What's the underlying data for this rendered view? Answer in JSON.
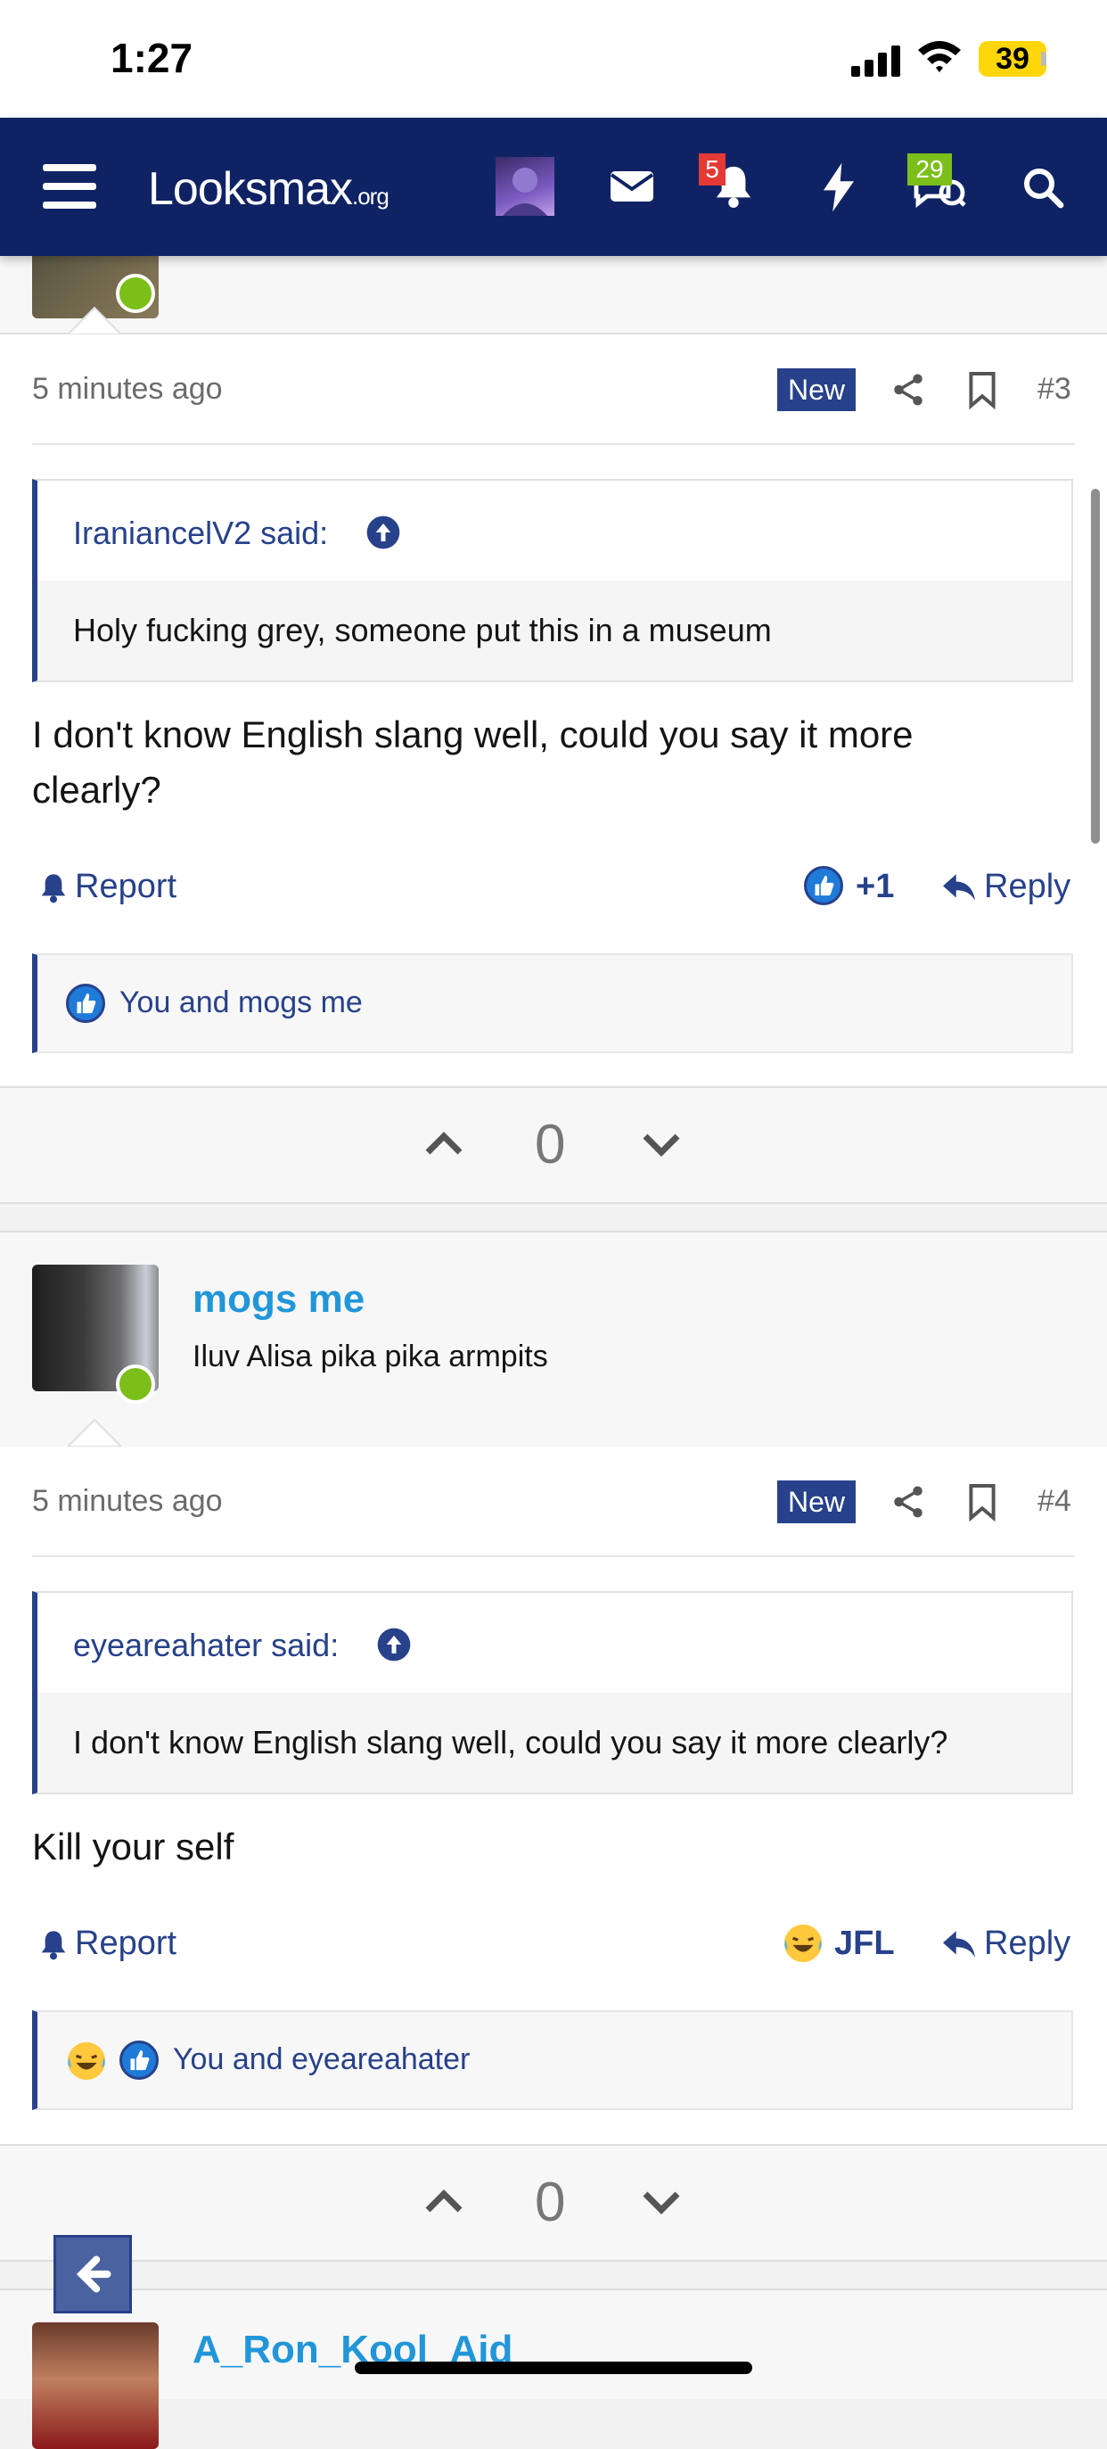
{
  "status_bar": {
    "time": "1:27",
    "battery": "39"
  },
  "navbar": {
    "logo_main": "Looksmax",
    "logo_suffix": ".org",
    "alerts_badge": "5",
    "conversations_badge": "29"
  },
  "posts": [
    {
      "time": "5 minutes ago",
      "new_label": "New",
      "number": "#3",
      "quote_author": "IraniancelV2 said:",
      "quote_text": "Holy fucking grey, someone put this in a museum",
      "message_line1": "I don't know English slang well, could you say it more",
      "message_line2": "clearly?",
      "report_label": "Report",
      "reaction_label": "+1",
      "reply_label": "Reply",
      "reaction_summary": "You and mogs me",
      "vote_count": "0"
    },
    {
      "username": "mogs me",
      "user_title": "Iluv Alisa pika pika armpits",
      "time": "5 minutes ago",
      "new_label": "New",
      "number": "#4",
      "quote_author": "eyeareahater said:",
      "quote_text": "I don't know English slang well, could you say it more clearly?",
      "message": "Kill your self",
      "report_label": "Report",
      "reaction_label": "JFL",
      "reply_label": "Reply",
      "reaction_summary": "You and eyeareahater",
      "vote_count": "0"
    },
    {
      "username": "A_Ron_Kool_Aid"
    }
  ],
  "colors": {
    "navbar": "#0f2364",
    "accent": "#27418a",
    "username": "#2196d8",
    "online": "#7cbf1a",
    "badge_red": "#e53935",
    "badge_green": "#7cbf1a"
  }
}
